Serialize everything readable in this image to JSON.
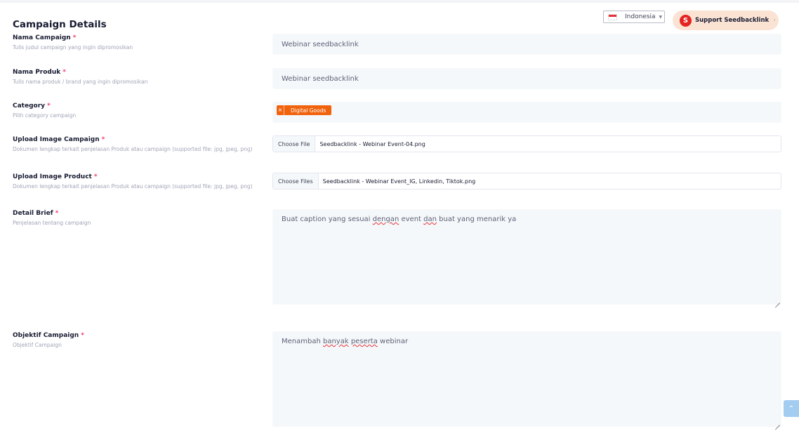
{
  "page": {
    "title": "Campaign Details"
  },
  "header": {
    "language": {
      "label": "Indonesia"
    },
    "support_button": {
      "logo_letter": "S",
      "label": "Support Seedbacklink"
    }
  },
  "fields": {
    "nama_campaign": {
      "label": "Nama Campaign",
      "required": "*",
      "help": "Tulis judul campaign yang ingin dipromosikan",
      "value": "Webinar seedbacklink"
    },
    "nama_produk": {
      "label": "Nama Produk",
      "required": "*",
      "help": "Tulis nama produk / brand yang ingin dipromosikan",
      "value": "Webinar seedbacklink"
    },
    "category": {
      "label": "Category",
      "required": "*",
      "help": "Pilih category campaign",
      "tags": [
        {
          "label": "Digital Goods",
          "remove": "×"
        }
      ]
    },
    "upload_image_campaign": {
      "label": "Upload Image Campaign",
      "required": "*",
      "help": "Dokumen lengkap terkait penjelasan Produk atau campaign (supported file: jpg, jpeg, png)",
      "button": "Choose File",
      "filename": "Seedbacklink - Webinar Event-04.png"
    },
    "upload_image_product": {
      "label": "Upload Image Product",
      "required": "*",
      "help": "Dokumen lengkap terkait penjelasan Produk atau campaign (supported file: jpg, jpeg, png)",
      "button": "Choose Files",
      "filename": "Seedbacklink - Webinar Event_IG, Linkedin, Tiktok.png"
    },
    "detail_brief": {
      "label": "Detail Brief",
      "required": "*",
      "help": "Penjelasan tentang campaign",
      "value_parts": [
        "Buat caption yang sesuai ",
        "dengan",
        " event ",
        "dan",
        " buat yang menarik ya"
      ]
    },
    "objektif_campaign": {
      "label": "Objektif Campaign",
      "required": "*",
      "help": "Objektif Campaign",
      "value_parts": [
        "Menambah ",
        "banyak",
        " ",
        "peserta",
        " webinar"
      ]
    }
  },
  "icons": {
    "flag": "indonesia-flag-icon",
    "caret": "caret-down-icon",
    "chevron": "chevron-right-icon",
    "scroll_top": "arrow-up-icon"
  },
  "glyphs": {
    "caret": "▼",
    "chevron": "›",
    "arrow_up": "⌃"
  },
  "colors": {
    "accent": "#f1620d",
    "required": "#f1416c",
    "support_bg": "#fbe3d4",
    "support_logo": "#e42421",
    "input_bg": "#f5f8fa"
  }
}
